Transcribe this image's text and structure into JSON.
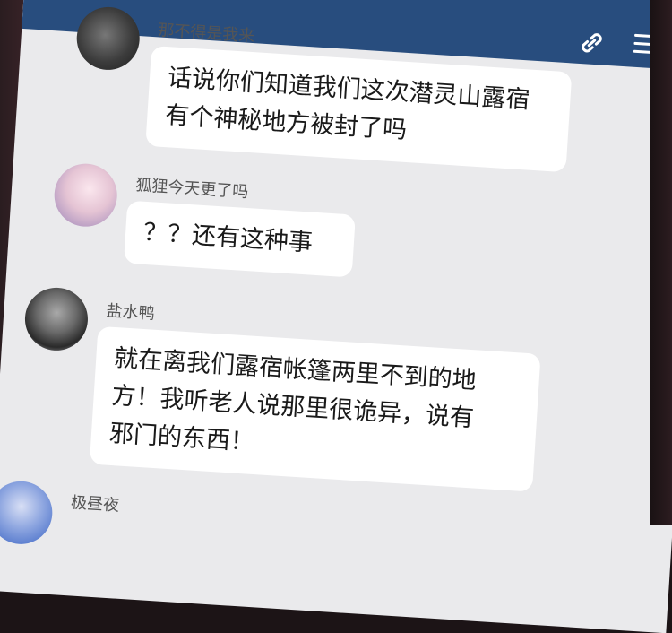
{
  "header": {
    "icons": [
      "link-icon",
      "menu-icon"
    ],
    "color": "#284d7e"
  },
  "messages": [
    {
      "sender": "那不得是我来",
      "lines": [
        "话说你们知道我们这次潜灵山露宿",
        "有个神秘地方被封了吗"
      ]
    },
    {
      "sender": "狐狸今天更了吗",
      "lines": [
        "？？还有这种事"
      ]
    },
    {
      "sender": "盐水鸭",
      "lines": [
        "就在离我们露宿帐篷两里不到的地",
        "方！我听老人说那里很诡异，说有",
        "邪门的东西！"
      ]
    },
    {
      "sender": "极昼夜",
      "lines": []
    }
  ]
}
